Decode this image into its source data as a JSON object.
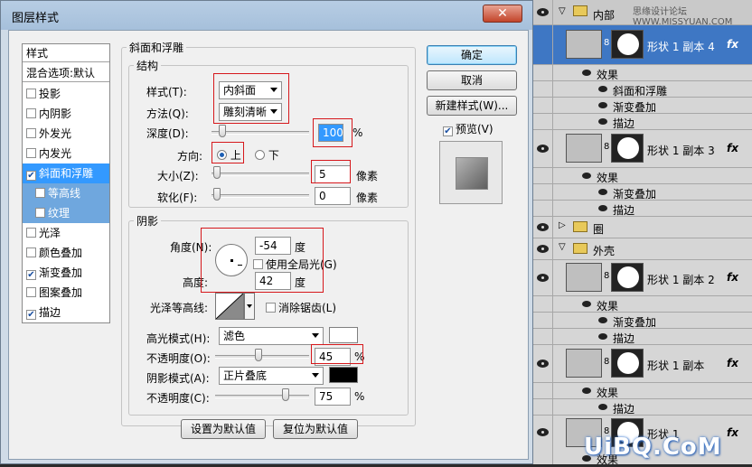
{
  "dialog": {
    "title": "图层样式",
    "close": "✕",
    "list_header": "样式",
    "blend_options": "混合选项:默认",
    "styles": [
      {
        "label": "投影",
        "checked": false
      },
      {
        "label": "内阴影",
        "checked": false
      },
      {
        "label": "外发光",
        "checked": false
      },
      {
        "label": "内发光",
        "checked": false
      },
      {
        "label": "斜面和浮雕",
        "checked": true
      },
      {
        "label": "等高线",
        "checked": false
      },
      {
        "label": "纹理",
        "checked": false
      },
      {
        "label": "光泽",
        "checked": false
      },
      {
        "label": "颜色叠加",
        "checked": false
      },
      {
        "label": "渐变叠加",
        "checked": true
      },
      {
        "label": "图案叠加",
        "checked": false
      },
      {
        "label": "描边",
        "checked": true
      }
    ],
    "section_title": "斜面和浮雕",
    "structure": {
      "legend": "结构",
      "style_label": "样式(T):",
      "style_value": "内斜面",
      "technique_label": "方法(Q):",
      "technique_value": "雕刻清晰",
      "depth_label": "深度(D):",
      "depth_value": "100",
      "depth_unit": "%",
      "direction_label": "方向:",
      "direction_up": "上",
      "direction_down": "下",
      "size_label": "大小(Z):",
      "size_value": "5",
      "size_unit": "像素",
      "soften_label": "软化(F):",
      "soften_value": "0",
      "soften_unit": "像素"
    },
    "shading": {
      "legend": "阴影",
      "angle_label": "角度(N):",
      "angle_value": "-54",
      "angle_unit": "度",
      "global_light": "使用全局光(G)",
      "altitude_label": "高度:",
      "altitude_value": "42",
      "altitude_unit": "度",
      "gloss_label": "光泽等高线:",
      "anti_alias": "消除锯齿(L)",
      "highlight_mode_label": "高光模式(H):",
      "highlight_mode_value": "滤色",
      "highlight_color": "#ffffff",
      "highlight_opacity_label": "不透明度(O):",
      "highlight_opacity_value": "45",
      "highlight_opacity_unit": "%",
      "shadow_mode_label": "阴影模式(A):",
      "shadow_mode_value": "正片叠底",
      "shadow_color": "#000000",
      "shadow_opacity_label": "不透明度(C):",
      "shadow_opacity_value": "75",
      "shadow_opacity_unit": "%"
    },
    "make_default": "设置为默认值",
    "reset_default": "复位为默认值",
    "ok": "确定",
    "cancel": "取消",
    "new_style": "新建样式(W)...",
    "preview": "预览(V)"
  },
  "layers": {
    "group_inner": "内部",
    "watermark_top": "思缘设计论坛 WWW.MISSYUAN.COM",
    "layer_copy4": "形状 1 副本 4",
    "effects": "效果",
    "bevel": "斜面和浮雕",
    "gradient": "渐变叠加",
    "stroke": "描边",
    "layer_copy3": "形状 1 副本 3",
    "group_circle": "圈",
    "group_outer": "外壳",
    "layer_copy2": "形状 1 副本 2",
    "layer_copy": "形状 1 副本",
    "layer_1": "形状 1",
    "fx": "fx",
    "watermark": "UiBQ.CoM"
  }
}
